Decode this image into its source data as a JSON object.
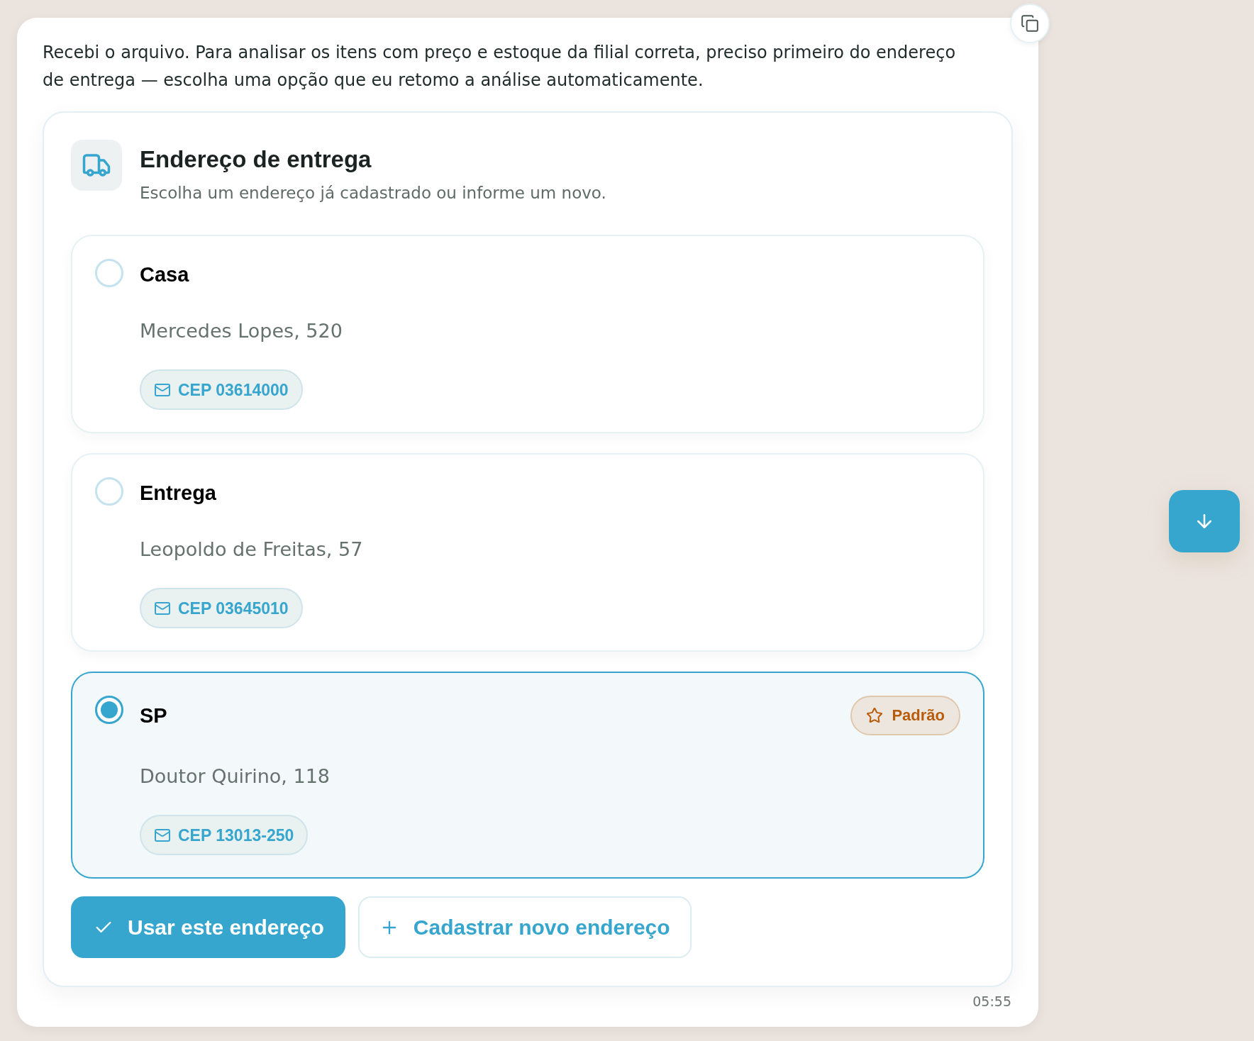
{
  "message": {
    "text": "Recebi o arquivo. Para analisar os itens com preço e estoque da filial correta, preciso primeiro do endereço de entrega — escolha uma opção que eu retomo a análise automaticamente.",
    "time": "05:55"
  },
  "address_picker": {
    "title": "Endereço de entrega",
    "subtitle": "Escolha um endereço já cadastrado ou informe um novo.",
    "addresses": [
      {
        "name": "Casa",
        "street": "Mercedes Lopes, 520",
        "cep": "CEP 03614000",
        "selected": false
      },
      {
        "name": "Entrega",
        "street": "Leopoldo de Freitas, 57",
        "cep": "CEP 03645010",
        "selected": false
      },
      {
        "name": "SP",
        "street": "Doutor Quirino, 118",
        "cep": "CEP 13013-250",
        "selected": true,
        "badge": "Padrão"
      }
    ],
    "actions": [
      {
        "kind": "primary",
        "label": "Usar este endereço"
      },
      {
        "kind": "secondary",
        "label": "Cadastrar novo endereço"
      }
    ]
  }
}
